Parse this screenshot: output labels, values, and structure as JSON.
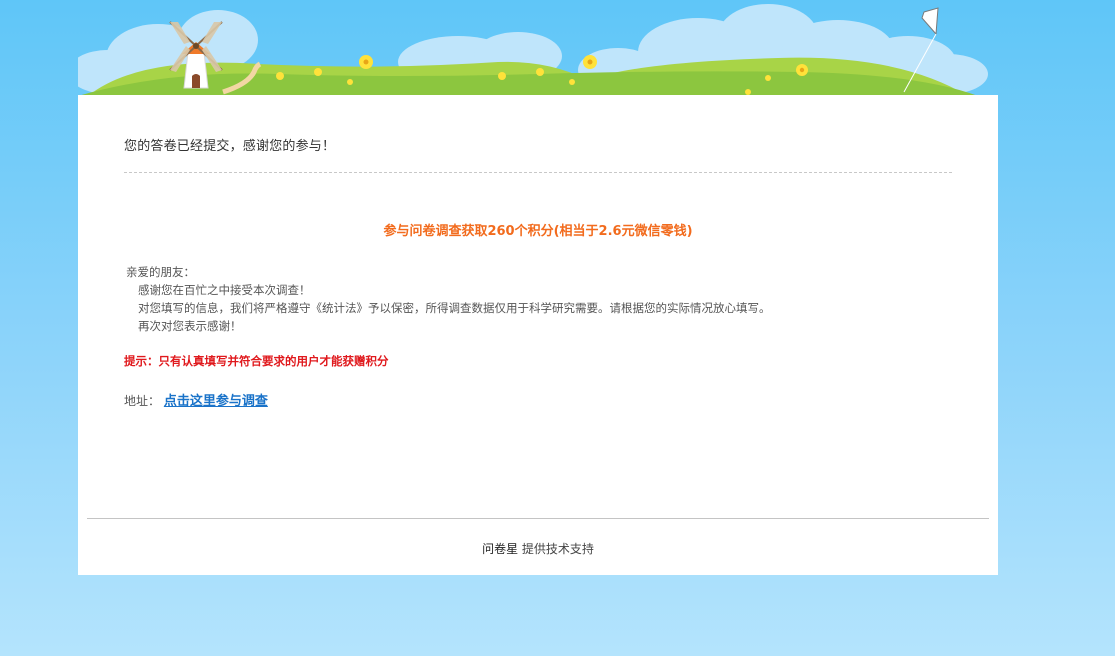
{
  "message": {
    "submitted": "您的答卷已经提交，感谢您的参与！"
  },
  "promo": {
    "headline": "参与问卷调查获取260个积分(相当于2.6元微信零钱)"
  },
  "letter": {
    "greeting": "亲爱的朋友：",
    "line1": "感谢您在百忙之中接受本次调查！",
    "line2": "对您填写的信息，我们将严格遵守《统计法》予以保密，所得调查数据仅用于科学研究需要。请根据您的实际情况放心填写。",
    "line3": "再次对您表示感谢！"
  },
  "tip": {
    "text": "提示：只有认真填写并符合要求的用户才能获赠积分"
  },
  "address": {
    "label": "地址：",
    "link_text": "点击这里参与调查"
  },
  "footer": {
    "brand": "问卷星",
    "suffix": " 提供技术支持"
  },
  "colors": {
    "background": "#5fc6f8",
    "headline": "#f26b1d",
    "tip": "#e0191d",
    "link": "#1a73c9"
  },
  "icons": {
    "banner": "windmill-meadow-kite-illustration"
  }
}
